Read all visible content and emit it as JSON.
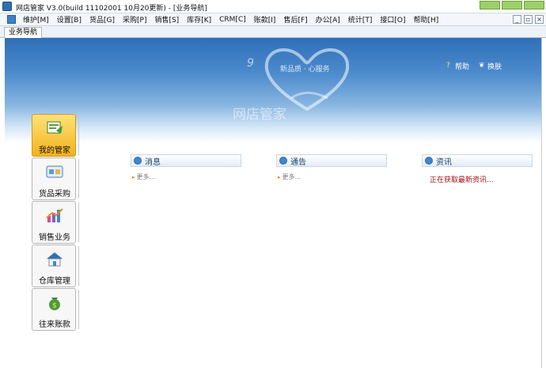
{
  "window": {
    "title": "网店管家 V3.0(build 11102001 10月20更新) - [业务导航]"
  },
  "menu": {
    "items": [
      "维护[M]",
      "设置[B]",
      "货品[G]",
      "采购[P]",
      "销售[S]",
      "库存[K]",
      "CRM[C]",
      "账款[I]",
      "售后[F]",
      "办公[A]",
      "统计[T]",
      "接口[O]",
      "帮助[H]"
    ],
    "mdi_minimize": "_",
    "mdi_restore": "▫",
    "mdi_close": "×"
  },
  "tabs": {
    "active": "业务导航"
  },
  "banner": {
    "nine": "9",
    "slogan": "新品质 · 心服务",
    "watermark": "网店管家",
    "help_label": "帮助",
    "skin_label": "换肤"
  },
  "nav": {
    "items": [
      {
        "label": "我的管家",
        "icon": "my-housekeeper-icon",
        "active": true
      },
      {
        "label": "货品采购",
        "icon": "goods-purchase-icon",
        "active": false
      },
      {
        "label": "销售业务",
        "icon": "sales-chart-icon",
        "active": false
      },
      {
        "label": "仓库管理",
        "icon": "warehouse-house-icon",
        "active": false
      },
      {
        "label": "往来账款",
        "icon": "money-bag-icon",
        "active": false
      }
    ]
  },
  "panels": {
    "messages": {
      "title": "消息",
      "more": "更多..."
    },
    "notices": {
      "title": "通告",
      "more": "更多..."
    },
    "news": {
      "title": "资讯",
      "status": "正在获取最新资讯..."
    }
  },
  "colors": {
    "accent": "#2f6fb8",
    "active_nav": "#f3b21c",
    "loading_text": "#a01212"
  }
}
